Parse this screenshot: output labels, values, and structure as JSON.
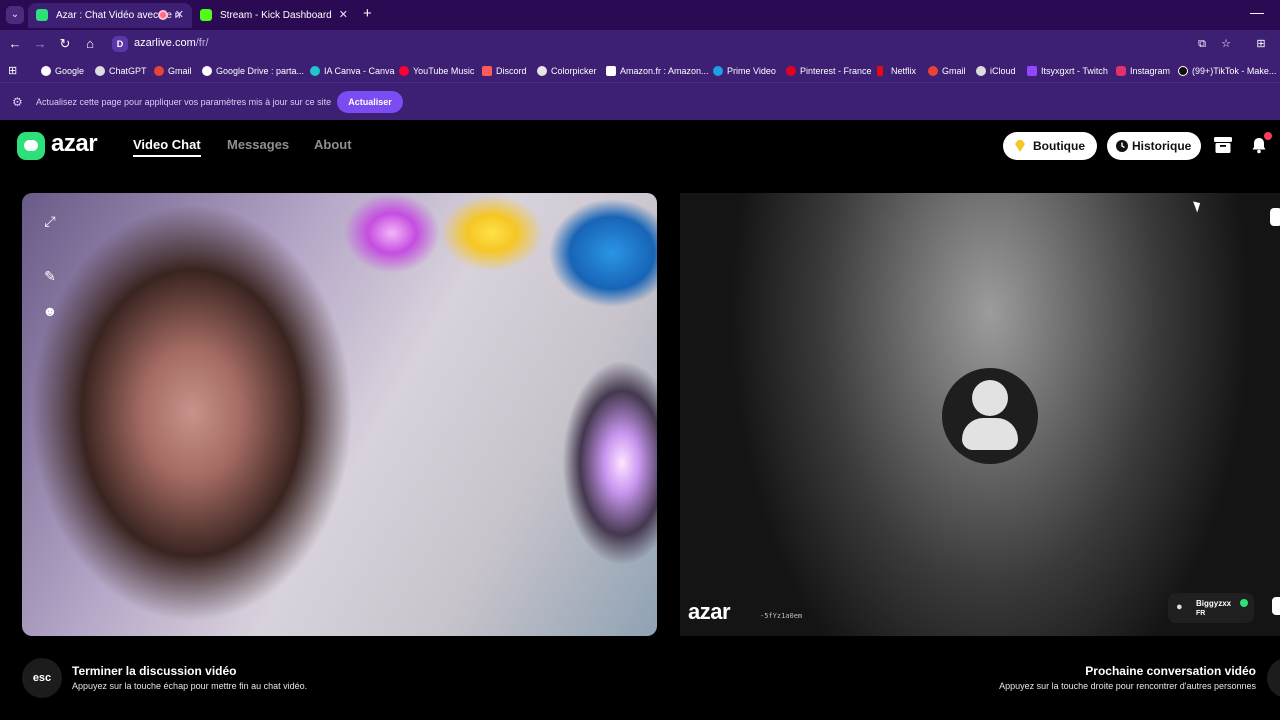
{
  "browser": {
    "tabs": [
      {
        "title": "Azar : Chat Vidéo avec de n",
        "active": true
      },
      {
        "title": "Stream - Kick Dashboard",
        "active": false
      }
    ],
    "new_tab_icon": "plus-icon",
    "url_host": "azarlive.com",
    "url_path": "/fr/",
    "bookmarks": [
      "Google",
      "ChatGPT",
      "Gmail",
      "Google Drive : parta...",
      "IA Canva - Canva",
      "YouTube Music",
      "Discord",
      "Colorpicker",
      "Amazon.fr : Amazon...",
      "Prime Video",
      "Pinterest - France",
      "Netflix",
      "Gmail",
      "iCloud",
      "Itsyxgxrt - Twitch",
      "Instagram",
      "(99+)TikTok - Make..."
    ],
    "infobar": {
      "message": "Actualisez cette page pour appliquer vos paramètres mis à jour sur ce site",
      "button": "Actualiser"
    }
  },
  "azar": {
    "logo": "azar",
    "nav": [
      "Video Chat",
      "Messages",
      "About"
    ],
    "shop_button": "Boutique",
    "history_button": "Historique",
    "notification_count": "1",
    "remote": {
      "watermark": "azar",
      "watermark_id": "-5fYz1a0em",
      "peer_name": "Biggyzxx",
      "peer_country": "FR"
    },
    "footer": {
      "left_key": "esc",
      "left_title": "Terminer la discussion vidéo",
      "left_sub": "Appuyez sur la touche échap pour mettre fin au chat vidéo.",
      "right_title": "Prochaine conversation vidéo",
      "right_sub": "Appuyez sur la touche droite pour rencontrer d'autres personnes"
    }
  },
  "colors": {
    "brand": "#2ee07a",
    "browser_frame": "#3d1f74",
    "update_button": "#7a4cf2"
  }
}
